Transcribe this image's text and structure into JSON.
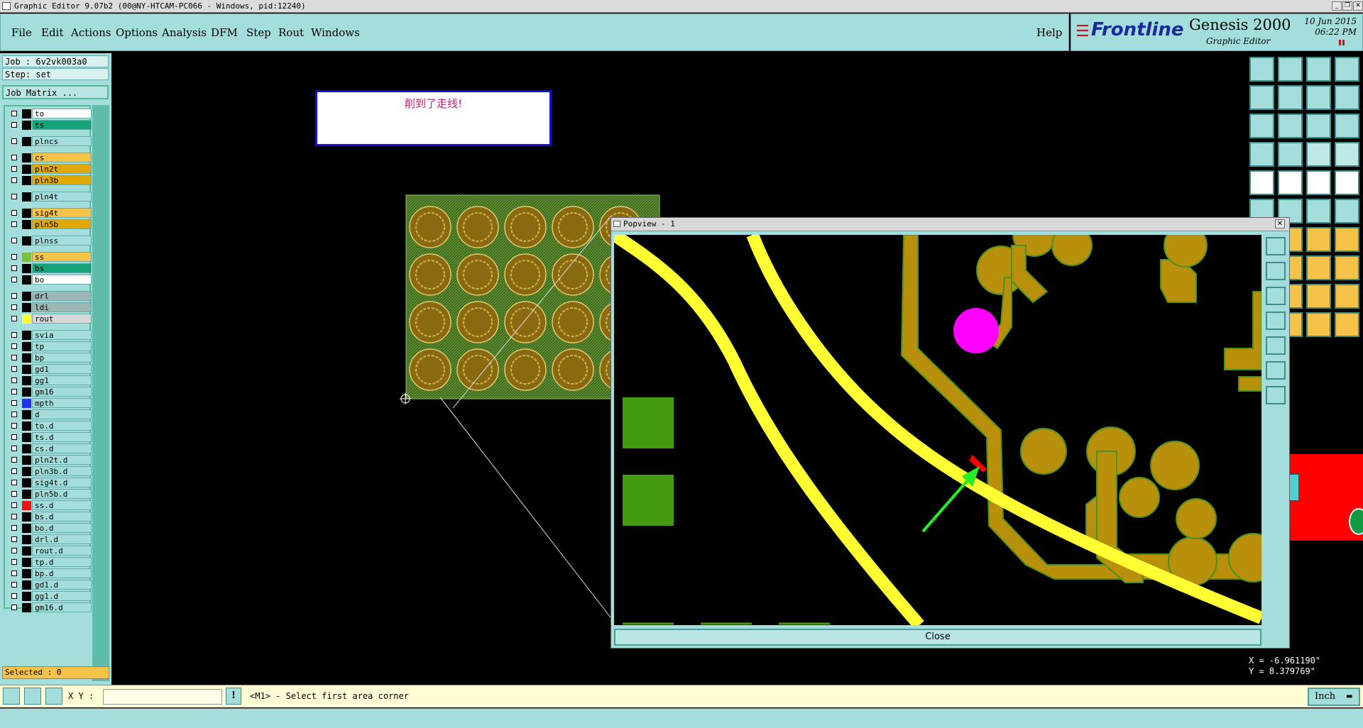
{
  "window": {
    "title": "Graphic Editor 9.07b2 (00@NY-HTCAM-PC066 - Windows, pid:12240)"
  },
  "menu": {
    "items": [
      "File",
      "Edit",
      "Actions",
      "Options",
      "Analysis",
      "DFM",
      "Step",
      "Rout",
      "Windows"
    ],
    "help": "Help"
  },
  "brand": {
    "logo": "Frontline",
    "product": "Genesis 2000",
    "subtitle": "Graphic Editor",
    "date": "10 Jun 2015",
    "time": "06:22 PM"
  },
  "job": {
    "job_label": "Job : 6v2vk003a0",
    "step_label": "Step: set",
    "matrix_button": "Job Matrix ..."
  },
  "layers": [
    {
      "name": "to",
      "color": "#ffffff"
    },
    {
      "name": "ts",
      "color": "#17a37a"
    },
    {
      "name": "plncs",
      "color": "#a3dedd"
    },
    {
      "name": "cs",
      "color": "#f5c24a"
    },
    {
      "name": "pln2t",
      "color": "#e0a800"
    },
    {
      "name": "pln3b",
      "color": "#e0a800"
    },
    {
      "name": "pln4t",
      "color": "#a3dedd"
    },
    {
      "name": "sig4t",
      "color": "#f5c24a"
    },
    {
      "name": "pln5b",
      "color": "#e0a800"
    },
    {
      "name": "plnss",
      "color": "#a3dedd"
    },
    {
      "name": "ss",
      "color": "#f5c24a"
    },
    {
      "name": "bs",
      "color": "#17a37a"
    },
    {
      "name": "bo",
      "color": "#ffffff"
    },
    {
      "name": "drl",
      "color": "#9cb8b6"
    },
    {
      "name": "ldi",
      "color": "#9cb8b6"
    },
    {
      "name": "rout",
      "color": "#d8d8d8"
    },
    {
      "name": "svia",
      "color": "#a3dedd"
    },
    {
      "name": "tp",
      "color": "#a3dedd"
    },
    {
      "name": "bp",
      "color": "#a3dedd"
    },
    {
      "name": "gd1",
      "color": "#a3dedd"
    },
    {
      "name": "gg1",
      "color": "#a3dedd"
    },
    {
      "name": "gm16",
      "color": "#a3dedd"
    },
    {
      "name": "mpth",
      "color": "#a3dedd"
    },
    {
      "name": "d",
      "color": "#a3dedd"
    },
    {
      "name": "to.d",
      "color": "#a3dedd"
    },
    {
      "name": "ts.d",
      "color": "#a3dedd"
    },
    {
      "name": "cs.d",
      "color": "#a3dedd"
    },
    {
      "name": "pln2t.d",
      "color": "#a3dedd"
    },
    {
      "name": "pln3b.d",
      "color": "#a3dedd"
    },
    {
      "name": "sig4t.d",
      "color": "#a3dedd"
    },
    {
      "name": "pln5b.d",
      "color": "#a3dedd"
    },
    {
      "name": "ss.d",
      "color": "#a3dedd"
    },
    {
      "name": "bs.d",
      "color": "#a3dedd"
    },
    {
      "name": "bo.d",
      "color": "#a3dedd"
    },
    {
      "name": "drl.d",
      "color": "#a3dedd"
    },
    {
      "name": "rout.d",
      "color": "#a3dedd"
    },
    {
      "name": "tp.d",
      "color": "#a3dedd"
    },
    {
      "name": "bp.d",
      "color": "#a3dedd"
    },
    {
      "name": "gd1.d",
      "color": "#a3dedd"
    },
    {
      "name": "gg1.d",
      "color": "#a3dedd"
    },
    {
      "name": "gm16.d",
      "color": "#a3dedd"
    }
  ],
  "selected": "Selected : 0",
  "message": "削到了走线!",
  "popview": {
    "title": "Popview - 1",
    "close": "Close"
  },
  "coords": {
    "x": "X = -6.961190\"",
    "y": "Y = 8.379769\""
  },
  "status": {
    "xy_label": "X Y :",
    "xy_value": "",
    "prompt": "<M1> - Select first area corner",
    "units": "Inch"
  },
  "colors": {
    "panel": "#a3dedd",
    "accent": "#5ebcab",
    "trace_yellow": "#ffff33",
    "copper": "#b8900c",
    "alert_red": "#ff0000"
  }
}
